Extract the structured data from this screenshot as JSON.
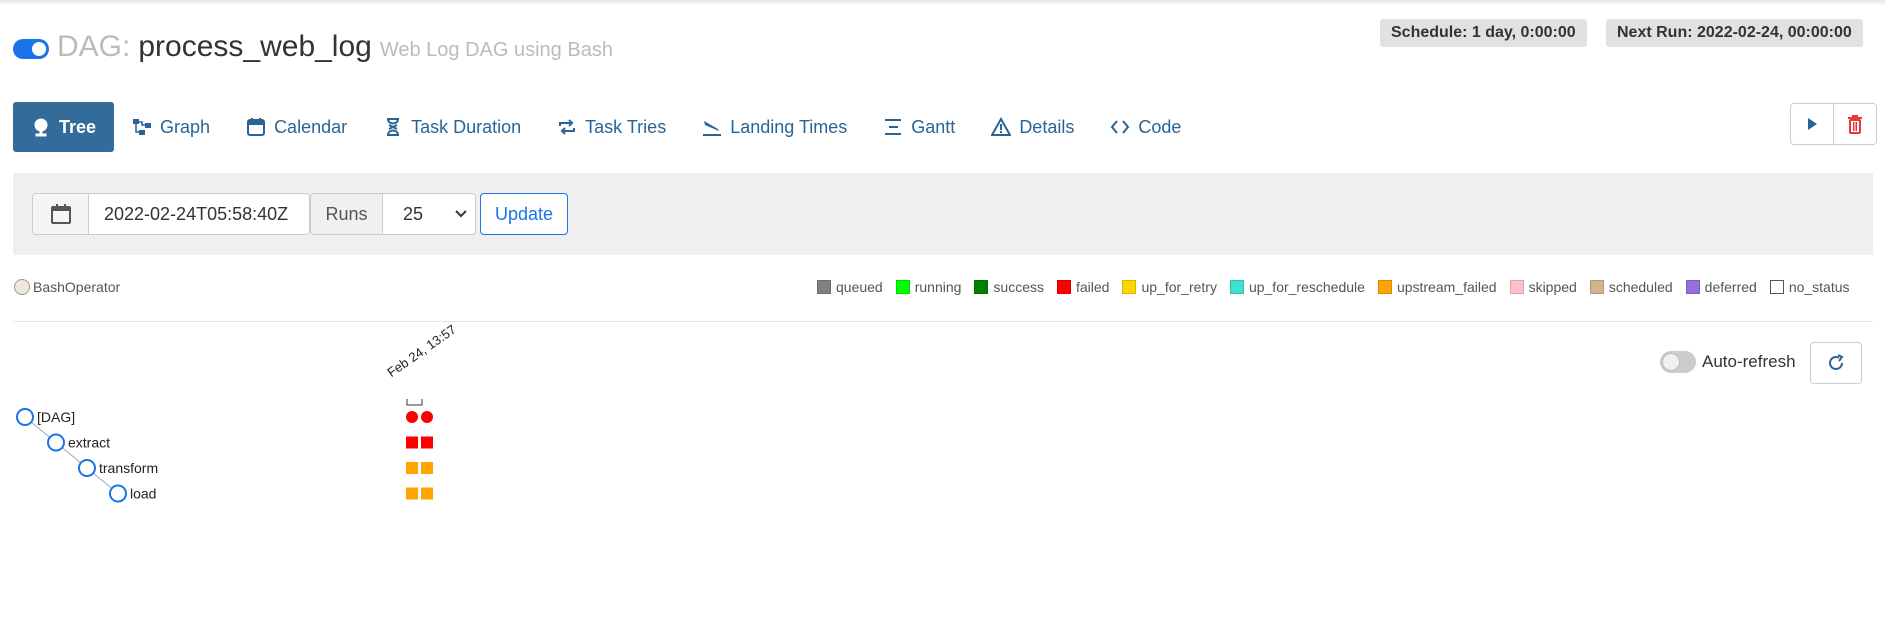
{
  "header": {
    "toggle_on": true,
    "dag_prefix": "DAG:",
    "dag_id": "process_web_log",
    "description": "Web Log DAG using Bash",
    "schedule": "Schedule: 1 day, 0:00:00",
    "next_run": "Next Run: 2022-02-24, 00:00:00"
  },
  "nav": {
    "tabs": [
      {
        "label": "Tree",
        "icon": "tree-icon",
        "active": true
      },
      {
        "label": "Graph",
        "icon": "graph-icon",
        "active": false
      },
      {
        "label": "Calendar",
        "icon": "calendar-icon",
        "active": false
      },
      {
        "label": "Task Duration",
        "icon": "hourglass-icon",
        "active": false
      },
      {
        "label": "Task Tries",
        "icon": "retry-icon",
        "active": false
      },
      {
        "label": "Landing Times",
        "icon": "plane-landing-icon",
        "active": false
      },
      {
        "label": "Gantt",
        "icon": "gantt-icon",
        "active": false
      },
      {
        "label": "Details",
        "icon": "warning-icon",
        "active": false
      },
      {
        "label": "Code",
        "icon": "code-icon",
        "active": false
      }
    ]
  },
  "actions": {
    "trigger_icon": "play-icon",
    "delete_icon": "trash-icon"
  },
  "filter": {
    "base_date": "2022-02-24T05:58:40Z",
    "runs_label": "Runs",
    "runs_value": "25",
    "update_label": "Update"
  },
  "legend": {
    "operator": {
      "label": "BashOperator",
      "color": "#ede8da"
    },
    "states": [
      {
        "label": "queued",
        "color": "#808080"
      },
      {
        "label": "running",
        "color": "#00ff00"
      },
      {
        "label": "success",
        "color": "#008000"
      },
      {
        "label": "failed",
        "color": "#ff0000"
      },
      {
        "label": "up_for_retry",
        "color": "#ffd700"
      },
      {
        "label": "up_for_reschedule",
        "color": "#40e0d0"
      },
      {
        "label": "upstream_failed",
        "color": "#ffa500"
      },
      {
        "label": "skipped",
        "color": "#ffc0cb"
      },
      {
        "label": "scheduled",
        "color": "#d2b48c"
      },
      {
        "label": "deferred",
        "color": "#9370db"
      },
      {
        "label": "no_status",
        "color": "#ffffff"
      }
    ]
  },
  "autorefresh": {
    "label": "Auto-refresh",
    "enabled": false
  },
  "tree": {
    "run_date_label": "Feb 24, 13:57",
    "nodes": [
      {
        "label": "[DAG]",
        "depth": 0,
        "states": [
          "failed",
          "failed"
        ],
        "shape": "circle"
      },
      {
        "label": "extract",
        "depth": 1,
        "states": [
          "failed",
          "failed"
        ],
        "shape": "square"
      },
      {
        "label": "transform",
        "depth": 2,
        "states": [
          "upstream_failed",
          "upstream_failed"
        ],
        "shape": "square"
      },
      {
        "label": "load",
        "depth": 3,
        "states": [
          "upstream_failed",
          "upstream_failed"
        ],
        "shape": "square"
      }
    ]
  }
}
